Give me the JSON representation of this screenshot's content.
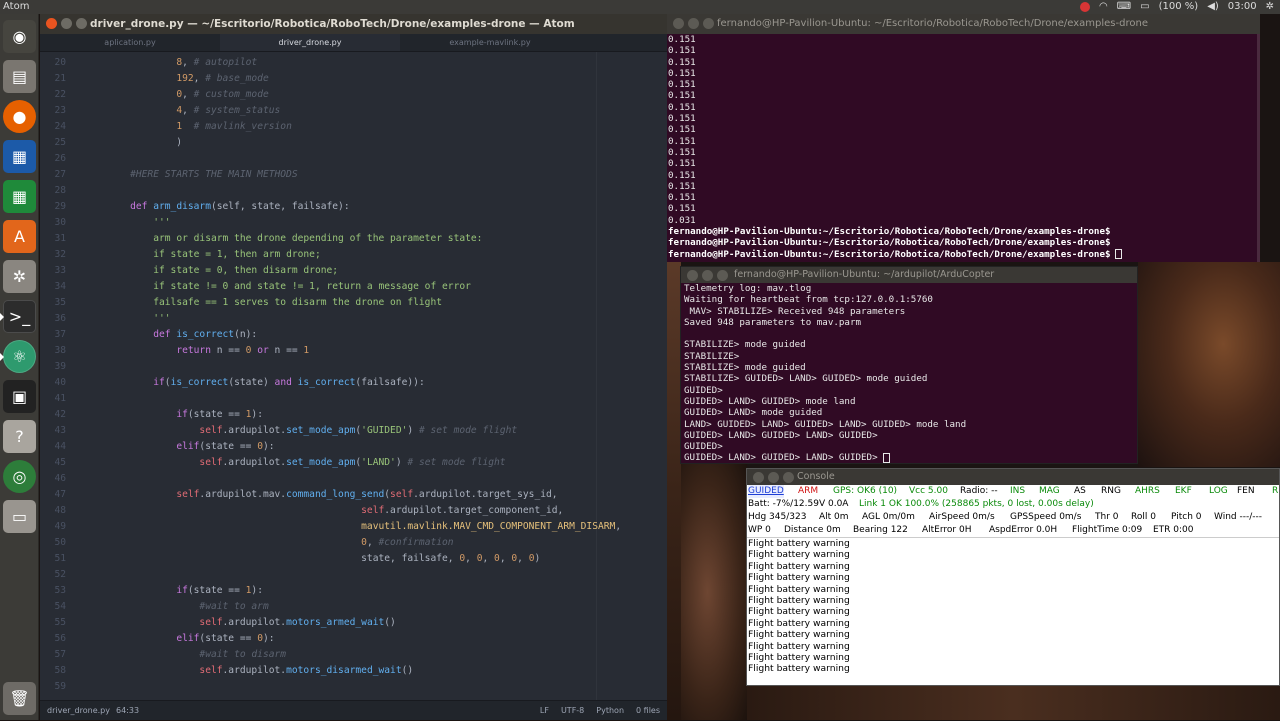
{
  "top_panel": {
    "app_name": "Atom",
    "battery": "(100 %)",
    "clock": "03:00"
  },
  "launcher": {
    "items": [
      "ubuntu-dash",
      "files",
      "firefox",
      "libreoffice-writer",
      "libreoffice-calc",
      "software-center",
      "system-settings",
      "terminal",
      "atom",
      "arduino",
      "help",
      "chrome",
      "removable-drive",
      "trash"
    ]
  },
  "atom": {
    "title": "driver_drone.py — ~/Escritorio/Robotica/RoboTech/Drone/examples-drone — Atom",
    "tabs": [
      "aplication.py",
      "driver_drone.py",
      "example-mavlink.py"
    ],
    "active_tab": 1,
    "lines": [
      {
        "n": "20",
        "s": [
          [
            "            ",
            ""
          ],
          [
            "8",
            "num"
          ],
          [
            ", ",
            ""
          ],
          [
            "# autopilot",
            "cm"
          ]
        ]
      },
      {
        "n": "21",
        "s": [
          [
            "            ",
            ""
          ],
          [
            "192",
            "num"
          ],
          [
            ", ",
            ""
          ],
          [
            "# base_mode",
            "cm"
          ]
        ]
      },
      {
        "n": "22",
        "s": [
          [
            "            ",
            ""
          ],
          [
            "0",
            "num"
          ],
          [
            ", ",
            ""
          ],
          [
            "# custom_mode",
            "cm"
          ]
        ]
      },
      {
        "n": "23",
        "s": [
          [
            "            ",
            ""
          ],
          [
            "4",
            "num"
          ],
          [
            ", ",
            ""
          ],
          [
            "# system_status",
            "cm"
          ]
        ]
      },
      {
        "n": "24",
        "s": [
          [
            "            ",
            ""
          ],
          [
            "1",
            "num"
          ],
          [
            "  ",
            ""
          ],
          [
            "# mavlink_version",
            "cm"
          ]
        ]
      },
      {
        "n": "25",
        "s": [
          [
            "            )",
            ""
          ]
        ]
      },
      {
        "n": "26",
        "s": [
          [
            "",
            ""
          ]
        ]
      },
      {
        "n": "27",
        "s": [
          [
            "    ",
            ""
          ],
          [
            "#HERE STARTS THE MAIN METHODS",
            "cm"
          ]
        ]
      },
      {
        "n": "28",
        "s": [
          [
            "",
            ""
          ]
        ]
      },
      {
        "n": "29",
        "s": [
          [
            "    ",
            ""
          ],
          [
            "def",
            "kw"
          ],
          [
            " ",
            ""
          ],
          [
            "arm_disarm",
            "fn"
          ],
          [
            "(self, state, failsafe):",
            ""
          ]
        ]
      },
      {
        "n": "30",
        "s": [
          [
            "        ",
            ""
          ],
          [
            "'''",
            "str"
          ]
        ]
      },
      {
        "n": "31",
        "s": [
          [
            "        ",
            ""
          ],
          [
            "arm or disarm the drone depending of the parameter state:",
            "str"
          ]
        ]
      },
      {
        "n": "32",
        "s": [
          [
            "        ",
            ""
          ],
          [
            "if state = 1, then arm drone;",
            "str"
          ]
        ]
      },
      {
        "n": "33",
        "s": [
          [
            "        ",
            ""
          ],
          [
            "if state = 0, then disarm drone;",
            "str"
          ]
        ]
      },
      {
        "n": "34",
        "s": [
          [
            "        ",
            ""
          ],
          [
            "if state != 0 and state != 1, return a message of error",
            "str"
          ]
        ]
      },
      {
        "n": "35",
        "s": [
          [
            "        ",
            ""
          ],
          [
            "failsafe == 1 serves to disarm the drone on flight",
            "str"
          ]
        ]
      },
      {
        "n": "36",
        "s": [
          [
            "        ",
            ""
          ],
          [
            "'''",
            "str"
          ]
        ]
      },
      {
        "n": "37",
        "s": [
          [
            "        ",
            ""
          ],
          [
            "def",
            "kw"
          ],
          [
            " ",
            ""
          ],
          [
            "is_correct",
            "fn"
          ],
          [
            "(n):",
            ""
          ]
        ]
      },
      {
        "n": "38",
        "s": [
          [
            "            ",
            ""
          ],
          [
            "return",
            "kw"
          ],
          [
            " n == ",
            ""
          ],
          [
            "0",
            "num"
          ],
          [
            " ",
            ""
          ],
          [
            "or",
            "kw"
          ],
          [
            " n == ",
            ""
          ],
          [
            "1",
            "num"
          ]
        ]
      },
      {
        "n": "39",
        "s": [
          [
            "",
            ""
          ]
        ]
      },
      {
        "n": "40",
        "s": [
          [
            "        ",
            ""
          ],
          [
            "if",
            "kw"
          ],
          [
            "(",
            ""
          ],
          [
            "is_correct",
            "fn"
          ],
          [
            "(state) ",
            ""
          ],
          [
            "and",
            "kw"
          ],
          [
            " ",
            ""
          ],
          [
            "is_correct",
            "fn"
          ],
          [
            "(failsafe)):",
            ""
          ]
        ]
      },
      {
        "n": "41",
        "s": [
          [
            "",
            ""
          ]
        ]
      },
      {
        "n": "42",
        "s": [
          [
            "            ",
            ""
          ],
          [
            "if",
            "kw"
          ],
          [
            "(state == ",
            ""
          ],
          [
            "1",
            "num"
          ],
          [
            "):",
            ""
          ]
        ]
      },
      {
        "n": "43",
        "s": [
          [
            "                ",
            ""
          ],
          [
            "self",
            "self"
          ],
          [
            ".ardupilot.",
            ""
          ],
          [
            "set_mode_apm",
            "fn"
          ],
          [
            "(",
            ""
          ],
          [
            "'GUIDED'",
            "str"
          ],
          [
            ") ",
            ""
          ],
          [
            "# set mode flight",
            "cm"
          ]
        ]
      },
      {
        "n": "44",
        "s": [
          [
            "            ",
            ""
          ],
          [
            "elif",
            "kw"
          ],
          [
            "(state == ",
            ""
          ],
          [
            "0",
            "num"
          ],
          [
            "):",
            ""
          ]
        ]
      },
      {
        "n": "45",
        "s": [
          [
            "                ",
            ""
          ],
          [
            "self",
            "self"
          ],
          [
            ".ardupilot.",
            ""
          ],
          [
            "set_mode_apm",
            "fn"
          ],
          [
            "(",
            ""
          ],
          [
            "'LAND'",
            "str"
          ],
          [
            ") ",
            ""
          ],
          [
            "# set mode flight",
            "cm"
          ]
        ]
      },
      {
        "n": "46",
        "s": [
          [
            "",
            ""
          ]
        ]
      },
      {
        "n": "47",
        "s": [
          [
            "            ",
            ""
          ],
          [
            "self",
            "self"
          ],
          [
            ".ardupilot.mav.",
            ""
          ],
          [
            "command_long_send",
            "fn"
          ],
          [
            "(",
            ""
          ],
          [
            "self",
            "self"
          ],
          [
            ".ardupilot.target_sys_id,",
            ""
          ]
        ]
      },
      {
        "n": "48",
        "s": [
          [
            "                                            ",
            ""
          ],
          [
            "self",
            "self"
          ],
          [
            ".ardupilot.target_component_id,",
            ""
          ]
        ]
      },
      {
        "n": "49",
        "s": [
          [
            "                                            ",
            ""
          ],
          [
            "mavutil.mavlink.MAV_CMD_COMPONENT_ARM_DISARM",
            "cls"
          ],
          [
            ",",
            ""
          ]
        ]
      },
      {
        "n": "50",
        "s": [
          [
            "                                            ",
            ""
          ],
          [
            "0",
            "num"
          ],
          [
            ", ",
            ""
          ],
          [
            "#confirmation",
            "cm"
          ]
        ]
      },
      {
        "n": "51",
        "s": [
          [
            "                                            state, failsafe, ",
            ""
          ],
          [
            "0",
            "num"
          ],
          [
            ", ",
            ""
          ],
          [
            "0",
            "num"
          ],
          [
            ", ",
            ""
          ],
          [
            "0",
            "num"
          ],
          [
            ", ",
            ""
          ],
          [
            "0",
            "num"
          ],
          [
            ", ",
            ""
          ],
          [
            "0",
            "num"
          ],
          [
            ")",
            ""
          ]
        ]
      },
      {
        "n": "52",
        "s": [
          [
            "",
            ""
          ]
        ]
      },
      {
        "n": "53",
        "s": [
          [
            "            ",
            ""
          ],
          [
            "if",
            "kw"
          ],
          [
            "(state == ",
            ""
          ],
          [
            "1",
            "num"
          ],
          [
            "):",
            ""
          ]
        ]
      },
      {
        "n": "54",
        "s": [
          [
            "                ",
            ""
          ],
          [
            "#wait to arm",
            "cm"
          ]
        ]
      },
      {
        "n": "55",
        "s": [
          [
            "                ",
            ""
          ],
          [
            "self",
            "self"
          ],
          [
            ".ardupilot.",
            ""
          ],
          [
            "motors_armed_wait",
            "fn"
          ],
          [
            "()",
            ""
          ]
        ]
      },
      {
        "n": "56",
        "s": [
          [
            "            ",
            ""
          ],
          [
            "elif",
            "kw"
          ],
          [
            "(state == ",
            ""
          ],
          [
            "0",
            "num"
          ],
          [
            "):",
            ""
          ]
        ]
      },
      {
        "n": "57",
        "s": [
          [
            "                ",
            ""
          ],
          [
            "#wait to disarm",
            "cm"
          ]
        ]
      },
      {
        "n": "58",
        "s": [
          [
            "                ",
            ""
          ],
          [
            "self",
            "self"
          ],
          [
            ".ardupilot.",
            ""
          ],
          [
            "motors_disarmed_wait",
            "fn"
          ],
          [
            "()",
            ""
          ]
        ]
      },
      {
        "n": "59",
        "s": [
          [
            "",
            ""
          ]
        ]
      }
    ],
    "status": {
      "file": "driver_drone.py",
      "cursor": "64:33",
      "line_ending": "LF",
      "encoding": "UTF-8",
      "grammar": "Python",
      "files": "0 files"
    }
  },
  "syntax_colors": {
    "kw": "#c678dd",
    "fn": "#61afef",
    "num": "#d19a66",
    "str": "#98c379",
    "cm": "#5c6370",
    "self": "#e06c75",
    "cls": "#e5c07b",
    "": "#abb2bf"
  },
  "terminal1": {
    "title": "fernando@HP-Pavilion-Ubuntu: ~/Escritorio/Robotica/RoboTech/Drone/examples-drone",
    "output": [
      "0.151",
      "0.151",
      "0.151",
      "0.151",
      "0.151",
      "0.151",
      "0.151",
      "0.151",
      "0.151",
      "0.151",
      "0.151",
      "0.151",
      "0.151",
      "0.151",
      "0.151",
      "0.151",
      "0.031"
    ],
    "prompt_user": "fernando@HP-Pavilion-Ubuntu",
    "prompt_path": ":~/Escritorio/Robotica/RoboTech/Drone/examples-drone$",
    "prompt_count": 3
  },
  "terminal2": {
    "title": "fernando@HP-Pavilion-Ubuntu: ~/ardupilot/ArduCopter",
    "lines": [
      "Telemetry log: mav.tlog",
      "Waiting for heartbeat from tcp:127.0.0.1:5760",
      " MAV> STABILIZE> Received 948 parameters",
      "Saved 948 parameters to mav.parm",
      "",
      "STABILIZE> mode guided",
      "STABILIZE>",
      "STABILIZE> mode guided",
      "STABILIZE> GUIDED> LAND> GUIDED> mode guided",
      "GUIDED>",
      "GUIDED> LAND> GUIDED> mode land",
      "GUIDED> LAND> mode guided",
      "LAND> GUIDED> LAND> GUIDED> LAND> GUIDED> mode land",
      "GUIDED> LAND> GUIDED> LAND> GUIDED>",
      "GUIDED>",
      "GUIDED> LAND> GUIDED> LAND> GUIDED> "
    ]
  },
  "console": {
    "title": "Console",
    "row1": [
      {
        "t": "GUIDED",
        "c": "#1f3fd6",
        "u": true
      },
      {
        "t": "ARM",
        "c": "#d01010"
      },
      {
        "t": "GPS: OK6 (10)",
        "c": "#0a8a0a"
      },
      {
        "t": "Vcc 5.00",
        "c": "#0a8a0a"
      },
      {
        "t": "Radio: --",
        "c": "#000000"
      },
      {
        "t": "INS",
        "c": "#0a8a0a"
      },
      {
        "t": "MAG",
        "c": "#0a8a0a"
      },
      {
        "t": "AS",
        "c": "#000000"
      },
      {
        "t": "RNG",
        "c": "#000000"
      },
      {
        "t": "AHRS",
        "c": "#0a8a0a"
      },
      {
        "t": "EKF",
        "c": "#0a8a0a"
      },
      {
        "t": "LOG",
        "c": "#0a8a0a"
      },
      {
        "t": "FEN",
        "c": "#000000"
      },
      {
        "t": "R",
        "c": "#0a8a0a"
      }
    ],
    "row2": [
      {
        "t": "Batt: -7%/12.59V 0.0A",
        "c": "#000000"
      },
      {
        "t": "Link 1 OK 100.0% (258865 pkts, 0 lost, 0.00s delay)",
        "c": "#0a8a0a"
      }
    ],
    "row3": [
      {
        "t": "Hdg 345/323"
      },
      {
        "t": "Alt 0m"
      },
      {
        "t": "AGL 0m/0m"
      },
      {
        "t": "AirSpeed 0m/s"
      },
      {
        "t": "GPSSpeed 0m/s"
      },
      {
        "t": "Thr 0"
      },
      {
        "t": "Roll 0"
      },
      {
        "t": "Pitch 0"
      },
      {
        "t": "Wind ---/---"
      }
    ],
    "row4": [
      {
        "t": "WP 0"
      },
      {
        "t": "Distance 0m"
      },
      {
        "t": "Bearing 122"
      },
      {
        "t": "AltError 0H"
      },
      {
        "t": "AspdError 0.0H"
      },
      {
        "t": "FlightTime 0:09"
      },
      {
        "t": "ETR 0:00"
      }
    ],
    "log": [
      "Flight battery warning",
      "Flight battery warning",
      "Flight battery warning",
      "Flight battery warning",
      "Flight battery warning",
      "Flight battery warning",
      "Flight battery warning",
      "Flight battery warning",
      "Flight battery warning",
      "Flight battery warning",
      "Flight battery warning",
      "Flight battery warning"
    ]
  }
}
